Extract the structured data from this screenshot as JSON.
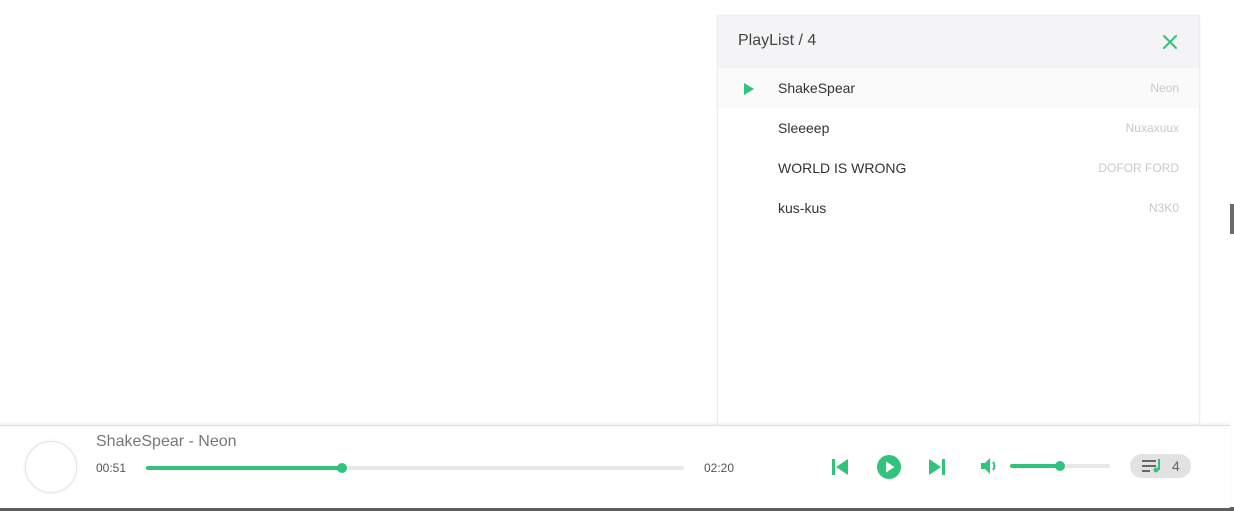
{
  "colors": {
    "accent": "#31c27c",
    "header_bg": "#f4f4f6",
    "artist_text": "#c9c9c9"
  },
  "playlist": {
    "title": "PlayList / 4",
    "close_icon": "close-icon",
    "tracks": [
      {
        "title": "ShakeSpear",
        "artist": "Neon",
        "active": true
      },
      {
        "title": "Sleeeep",
        "artist": "Nuxaxuux",
        "active": false
      },
      {
        "title": "WORLD IS WRONG",
        "artist": "DOFOR FORD",
        "active": false
      },
      {
        "title": "kus-kus",
        "artist": "N3K0",
        "active": false
      }
    ]
  },
  "player": {
    "now_playing": "ShakeSpear - Neon",
    "current_time": "00:51",
    "total_time": "02:20",
    "progress_fraction": 0.364,
    "volume_fraction": 0.5,
    "playlist_count": "4",
    "icons": {
      "prev": "skip-previous-icon",
      "play": "play-circle-icon",
      "next": "skip-next-icon",
      "volume": "volume-icon",
      "playlist": "playlist-icon"
    }
  }
}
